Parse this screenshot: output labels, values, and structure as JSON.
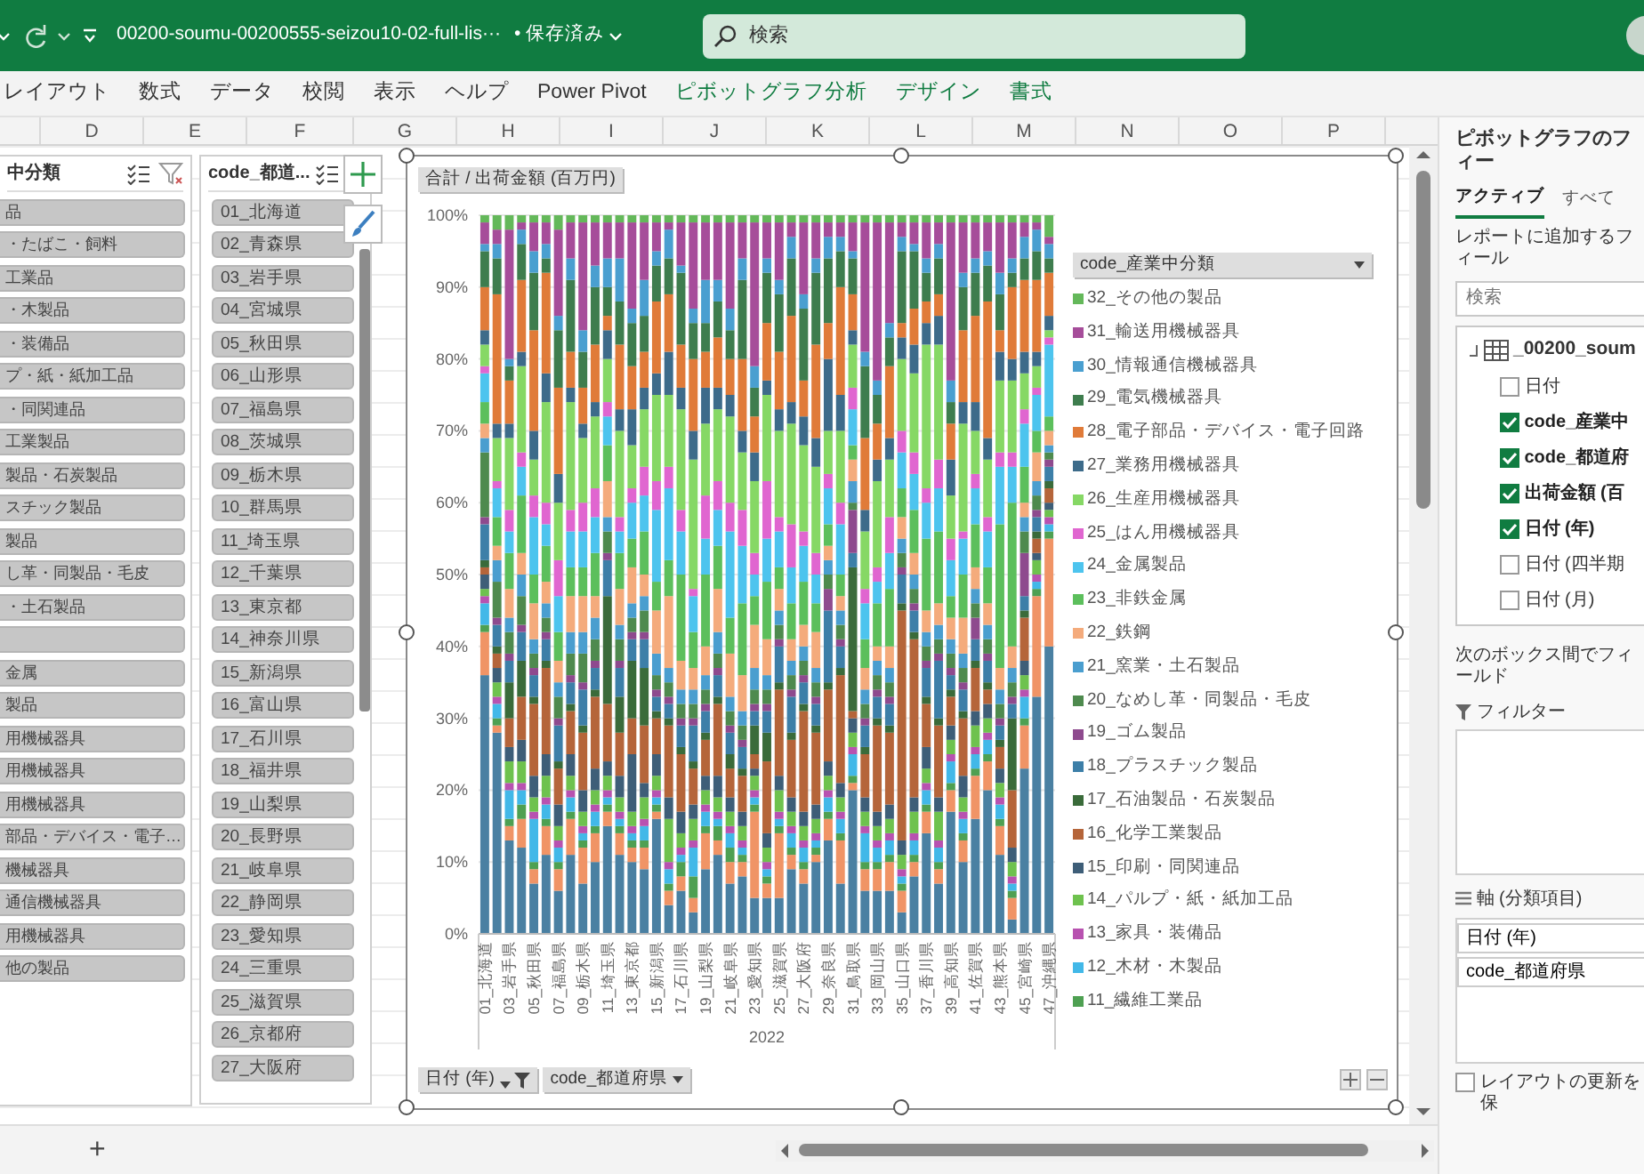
{
  "title_bar": {
    "file_name": "00200-soumu-00200555-seizou10-02-full-lis···",
    "save_status": "• 保存済み",
    "search_placeholder": "検索"
  },
  "ribbon_tabs": [
    {
      "label": "レイアウト",
      "kind": "normal"
    },
    {
      "label": "数式",
      "kind": "normal"
    },
    {
      "label": "データ",
      "kind": "normal"
    },
    {
      "label": "校閲",
      "kind": "normal"
    },
    {
      "label": "表示",
      "kind": "normal"
    },
    {
      "label": "ヘルプ",
      "kind": "normal"
    },
    {
      "label": "Power Pivot",
      "kind": "normal"
    },
    {
      "label": "ピボットグラフ分析",
      "kind": "contextual"
    },
    {
      "label": "デザイン",
      "kind": "contextual"
    },
    {
      "label": "書式",
      "kind": "contextual"
    }
  ],
  "column_headers": [
    "D",
    "E",
    "F",
    "G",
    "H",
    "I",
    "J",
    "K",
    "L",
    "M",
    "N",
    "O",
    "P"
  ],
  "slicers": [
    {
      "title": "中分類",
      "items": [
        {
          "label": "品",
          "selected": true
        },
        {
          "label": "・たばこ・飼料",
          "selected": true
        },
        {
          "label": "工業品",
          "selected": true
        },
        {
          "label": "・木製品",
          "selected": true
        },
        {
          "label": "・装備品",
          "selected": true
        },
        {
          "label": "プ・紙・紙加工品",
          "selected": true
        },
        {
          "label": "・同関連品",
          "selected": true
        },
        {
          "label": "工業製品",
          "selected": true
        },
        {
          "label": "製品・石炭製品",
          "selected": true
        },
        {
          "label": "スチック製品",
          "selected": true
        },
        {
          "label": "製品",
          "selected": true
        },
        {
          "label": "し革・同製品・毛皮",
          "selected": true
        },
        {
          "label": "・土石製品",
          "selected": true
        },
        {
          "selected": true
        },
        {
          "label": "金属",
          "selected": true
        },
        {
          "label": "製品",
          "selected": true
        },
        {
          "label": "用機械器具",
          "selected": true
        },
        {
          "label": "用機械器具",
          "selected": true
        },
        {
          "label": "用機械器具",
          "selected": true
        },
        {
          "label": "部品・デバイス・電子…",
          "selected": true
        },
        {
          "label": "機械器具",
          "selected": true
        },
        {
          "label": "通信機械器具",
          "selected": true
        },
        {
          "label": "用機械器具",
          "selected": true
        },
        {
          "label": "他の製品",
          "selected": true
        }
      ]
    },
    {
      "title": "code_都道...",
      "items": [
        {
          "label": "01_北海道",
          "selected": true
        },
        {
          "label": "02_青森県",
          "selected": true
        },
        {
          "label": "03_岩手県",
          "selected": true
        },
        {
          "label": "04_宮城県",
          "selected": true
        },
        {
          "label": "05_秋田県",
          "selected": true
        },
        {
          "label": "06_山形県",
          "selected": true
        },
        {
          "label": "07_福島県",
          "selected": true
        },
        {
          "label": "08_茨城県",
          "selected": true
        },
        {
          "label": "09_栃木県",
          "selected": true
        },
        {
          "label": "10_群馬県",
          "selected": true
        },
        {
          "label": "11_埼玉県",
          "selected": true
        },
        {
          "label": "12_千葉県",
          "selected": true
        },
        {
          "label": "13_東京都",
          "selected": true
        },
        {
          "label": "14_神奈川県",
          "selected": true
        },
        {
          "label": "15_新潟県",
          "selected": true
        },
        {
          "label": "16_富山県",
          "selected": true
        },
        {
          "label": "17_石川県",
          "selected": true
        },
        {
          "label": "18_福井県",
          "selected": true
        },
        {
          "label": "19_山梨県",
          "selected": true
        },
        {
          "label": "20_長野県",
          "selected": true
        },
        {
          "label": "21_岐阜県",
          "selected": true
        },
        {
          "label": "22_静岡県",
          "selected": true
        },
        {
          "label": "23_愛知県",
          "selected": true
        },
        {
          "label": "24_三重県",
          "selected": true
        },
        {
          "label": "25_滋賀県",
          "selected": true
        },
        {
          "label": "26_京都府",
          "selected": true
        },
        {
          "label": "27_大阪府",
          "selected": true
        }
      ]
    }
  ],
  "chart": {
    "value_field_button": "合計 / 出荷金額 (百万円)",
    "legend_field_button": "code_産業中分類",
    "axis_field_buttons": [
      {
        "label": "日付 (年)",
        "filtered": true
      },
      {
        "label": "code_都道府県",
        "filtered": false
      }
    ],
    "chart_data": {
      "type": "bar",
      "stacked": true,
      "grid": true,
      "orientation": "vertical",
      "xlabel": "2022",
      "xlim": [
        0.5,
        47.5
      ],
      "ylim": [
        0,
        100
      ],
      "x": [
        1,
        2,
        3,
        4,
        5,
        6,
        7,
        8,
        9,
        10,
        11,
        12,
        13,
        14,
        15,
        16,
        17,
        18,
        19,
        20,
        21,
        22,
        23,
        24,
        25,
        26,
        27,
        28,
        29,
        30,
        31,
        32,
        33,
        34,
        35,
        36,
        37,
        38,
        39,
        40,
        41,
        42,
        43,
        44,
        45,
        46,
        47
      ],
      "xticks": [
        {
          "value": 1,
          "label": "01_北海道"
        },
        {
          "value": 3,
          "label": "03_岩手県"
        },
        {
          "value": 5,
          "label": "05_秋田県"
        },
        {
          "value": 7,
          "label": "07_福島県"
        },
        {
          "value": 9,
          "label": "09_栃木県"
        },
        {
          "value": 11,
          "label": "11_埼玉県"
        },
        {
          "value": 13,
          "label": "13_東京都"
        },
        {
          "value": 15,
          "label": "15_新潟県"
        },
        {
          "value": 17,
          "label": "17_石川県"
        },
        {
          "value": 19,
          "label": "19_山梨県"
        },
        {
          "value": 21,
          "label": "21_岐阜県"
        },
        {
          "value": 23,
          "label": "23_愛知県"
        },
        {
          "value": 25,
          "label": "25_滋賀県"
        },
        {
          "value": 27,
          "label": "27_大阪府"
        },
        {
          "value": 29,
          "label": "29_奈良県"
        },
        {
          "value": 31,
          "label": "31_鳥取県"
        },
        {
          "value": 33,
          "label": "33_岡山県"
        },
        {
          "value": 35,
          "label": "35_山口県"
        },
        {
          "value": 37,
          "label": "37_香川県"
        },
        {
          "value": 39,
          "label": "39_高知県"
        },
        {
          "value": 41,
          "label": "41_佐賀県"
        },
        {
          "value": 43,
          "label": "43_熊本県"
        },
        {
          "value": 45,
          "label": "45_宮崎県"
        },
        {
          "value": 47,
          "label": "47_沖縄県"
        }
      ],
      "yticks": [
        {
          "value": 0,
          "label": "0%"
        },
        {
          "value": 10,
          "label": "10%"
        },
        {
          "value": 20,
          "label": "20%"
        },
        {
          "value": 30,
          "label": "30%"
        },
        {
          "value": 40,
          "label": "40%"
        },
        {
          "value": 50,
          "label": "50%"
        },
        {
          "value": 60,
          "label": "60%"
        },
        {
          "value": 70,
          "label": "70%"
        },
        {
          "value": 80,
          "label": "80%"
        },
        {
          "value": 90,
          "label": "90%"
        },
        {
          "value": 100,
          "label": "100%"
        }
      ],
      "series": [
        {
          "color": "#4a80a2",
          "values": [
            36,
            28,
            13,
            12,
            7,
            11,
            6,
            11,
            7,
            10,
            15,
            11,
            10,
            9,
            16,
            4,
            6,
            3,
            9,
            11,
            7,
            8,
            5,
            5,
            5,
            9,
            7,
            10,
            13,
            7,
            20,
            6,
            6,
            6,
            3,
            8,
            14,
            7,
            17,
            10,
            16,
            20,
            11,
            2,
            23,
            33,
            40
          ]
        },
        {
          "color": "#f09466",
          "values": [
            6,
            1,
            2,
            4,
            2,
            4,
            3,
            5,
            5,
            4,
            2,
            3,
            2,
            3,
            1,
            2,
            2,
            2,
            5,
            2,
            3,
            2,
            12,
            2,
            9,
            2,
            2,
            1,
            3,
            6,
            1,
            3,
            3,
            4,
            3,
            2,
            3,
            2,
            3,
            3,
            6,
            4,
            4,
            3,
            6,
            14,
            15
          ]
        },
        {
          "name": "11_繊維工業品",
          "color": "#4ea052",
          "values": [
            1,
            1,
            1,
            2,
            1,
            1,
            1,
            1,
            1,
            1,
            1,
            1,
            1,
            1,
            1,
            1,
            2,
            3,
            1,
            2,
            2,
            1,
            1,
            1,
            1,
            1,
            1,
            1,
            1,
            1,
            1,
            1,
            1,
            1,
            1,
            1,
            1,
            1,
            1,
            1,
            1,
            1,
            1,
            1,
            1,
            1,
            1
          ]
        },
        {
          "name": "12_木材・木製品",
          "color": "#42b8e8",
          "values": [
            3,
            2,
            4,
            2,
            6,
            2,
            2,
            2,
            1,
            2,
            1,
            1,
            1,
            2,
            1,
            2,
            1,
            4,
            2,
            1,
            2,
            1,
            1,
            1,
            1,
            2,
            2,
            1,
            2,
            2,
            3,
            4,
            2,
            2,
            1,
            2,
            2,
            2,
            3,
            2,
            2,
            2,
            2,
            1,
            3,
            1,
            1
          ]
        },
        {
          "name": "13_家具・装備品",
          "color": "#b852b0",
          "values": [
            1,
            1,
            1,
            1,
            1,
            1,
            1,
            1,
            1,
            1,
            1,
            1,
            1,
            1,
            1,
            1,
            1,
            1,
            1,
            1,
            1,
            1,
            1,
            1,
            1,
            1,
            1,
            1,
            1,
            1,
            1,
            1,
            1,
            1,
            1,
            1,
            1,
            1,
            1,
            1,
            1,
            1,
            1,
            1,
            1,
            1,
            1
          ]
        },
        {
          "name": "14_パルプ・紙・紙加工品",
          "color": "#6ec24e",
          "values": [
            1,
            2,
            3,
            3,
            2,
            3,
            2,
            2,
            2,
            2,
            2,
            2,
            2,
            3,
            2,
            6,
            2,
            3,
            2,
            2,
            2,
            2,
            2,
            2,
            3,
            2,
            2,
            2,
            2,
            2,
            2,
            2,
            2,
            2,
            2,
            3,
            2,
            4,
            2,
            2,
            3,
            2,
            2,
            2,
            2,
            2,
            1
          ]
        },
        {
          "name": "15_印刷・同関連品",
          "color": "#3e5e78",
          "values": [
            2,
            2,
            2,
            3,
            3,
            3,
            3,
            3,
            3,
            3,
            2,
            3,
            8,
            2,
            3,
            3,
            3,
            2,
            2,
            3,
            2,
            2,
            1,
            2,
            2,
            2,
            2,
            2,
            2,
            2,
            2,
            2,
            2,
            2,
            2,
            2,
            3,
            2,
            2,
            3,
            2,
            2,
            2,
            2,
            2,
            1,
            1
          ]
        },
        {
          "name": "16_化学工業製品",
          "color": "#b5653a",
          "values": [
            1,
            2,
            4,
            6,
            10,
            12,
            5,
            6,
            8,
            10,
            8,
            6,
            5,
            8,
            5,
            10,
            8,
            5,
            5,
            10,
            4,
            5,
            2,
            10,
            12,
            8,
            14,
            10,
            10,
            15,
            1,
            6,
            12,
            10,
            32,
            22,
            6,
            10,
            4,
            8,
            6,
            2,
            3,
            8,
            6,
            2,
            2
          ]
        },
        {
          "name": "17_石油製品・石炭製品",
          "color": "#3a6b3a",
          "values": [
            1,
            1,
            5,
            5,
            1,
            1,
            1,
            1,
            1,
            1,
            15,
            5,
            8,
            8,
            1,
            1,
            1,
            1,
            1,
            1,
            2,
            1,
            4,
            4,
            1,
            1,
            1,
            1,
            1,
            1,
            20,
            1,
            1,
            1,
            1,
            1,
            1,
            1,
            1,
            1,
            1,
            1,
            1,
            10,
            1,
            1,
            1
          ]
        },
        {
          "name": "18_プラスチック製品",
          "color": "#3d7fa8",
          "values": [
            5,
            3,
            3,
            4,
            3,
            3,
            5,
            3,
            5,
            3,
            5,
            4,
            3,
            4,
            2,
            2,
            3,
            5,
            3,
            3,
            3,
            3,
            2,
            3,
            5,
            5,
            3,
            3,
            10,
            3,
            2,
            3,
            3,
            3,
            4,
            3,
            4,
            8,
            2,
            3,
            3,
            3,
            2,
            2,
            2,
            2,
            2
          ]
        },
        {
          "name": "19_ゴム製品",
          "color": "#8e4a8e",
          "values": [
            1,
            1,
            1,
            1,
            1,
            1,
            1,
            1,
            1,
            1,
            1,
            1,
            1,
            1,
            1,
            1,
            1,
            1,
            1,
            1,
            1,
            1,
            1,
            1,
            1,
            1,
            1,
            1,
            3,
            1,
            6,
            1,
            1,
            1,
            1,
            1,
            1,
            1,
            1,
            1,
            3,
            1,
            1,
            1,
            6,
            1,
            1
          ]
        },
        {
          "name": "20_なめし革・同製品・毛皮",
          "color": "#4e8a4e",
          "values": [
            9,
            5,
            3,
            4,
            2,
            2,
            3,
            3,
            4,
            3,
            3,
            3,
            2,
            3,
            2,
            2,
            2,
            2,
            2,
            2,
            2,
            2,
            2,
            2,
            2,
            2,
            2,
            2,
            2,
            2,
            1,
            2,
            2,
            2,
            2,
            2,
            2,
            2,
            2,
            2,
            2,
            2,
            2,
            2,
            3,
            2,
            1
          ]
        },
        {
          "name": "21_窯業・土石製品",
          "color": "#4a9ecf",
          "values": [
            2,
            3,
            2,
            3,
            2,
            2,
            2,
            3,
            3,
            3,
            2,
            2,
            2,
            2,
            3,
            2,
            2,
            2,
            2,
            3,
            2,
            2,
            3,
            2,
            2,
            2,
            2,
            2,
            2,
            2,
            3,
            2,
            2,
            2,
            2,
            2,
            2,
            2,
            2,
            2,
            2,
            2,
            2,
            2,
            2,
            2,
            1
          ]
        },
        {
          "name": "22_鉄鋼",
          "color": "#f4ab7c",
          "values": [
            2,
            2,
            4,
            3,
            5,
            3,
            3,
            5,
            5,
            3,
            5,
            5,
            5,
            3,
            6,
            10,
            4,
            3,
            4,
            6,
            6,
            5,
            6,
            5,
            3,
            3,
            3,
            5,
            2,
            2,
            3,
            3,
            2,
            3,
            3,
            3,
            3,
            3,
            3,
            5,
            3,
            3,
            3,
            3,
            2,
            4,
            2
          ]
        },
        {
          "name": "23_非鉄金属",
          "color": "#5cbf5c",
          "values": [
            3,
            4,
            5,
            8,
            4,
            5,
            4,
            4,
            4,
            6,
            5,
            5,
            4,
            6,
            4,
            5,
            12,
            5,
            10,
            6,
            5,
            10,
            4,
            8,
            3,
            5,
            6,
            4,
            3,
            3,
            2,
            4,
            6,
            8,
            4,
            6,
            10,
            10,
            3,
            6,
            6,
            5,
            20,
            20,
            5,
            3,
            2
          ]
        },
        {
          "name": "24_金属製品",
          "color": "#4dc4ee",
          "values": [
            4,
            4,
            3,
            4,
            8,
            3,
            5,
            5,
            5,
            5,
            4,
            3,
            5,
            5,
            10,
            10,
            6,
            5,
            5,
            5,
            12,
            8,
            3,
            6,
            5,
            5,
            5,
            4,
            5,
            7,
            5,
            5,
            3,
            5,
            5,
            5,
            5,
            6,
            5,
            5,
            5,
            5,
            8,
            5,
            6,
            5,
            10
          ]
        },
        {
          "name": "25_はん用機械器具",
          "color": "#e066d0",
          "values": [
            1,
            1,
            3,
            2,
            3,
            3,
            5,
            3,
            4,
            4,
            2,
            2,
            2,
            4,
            4,
            3,
            3,
            1,
            6,
            4,
            4,
            5,
            3,
            8,
            2,
            6,
            2,
            3,
            2,
            3,
            3,
            2,
            2,
            5,
            3,
            3,
            2,
            4,
            3,
            1,
            2,
            2,
            2,
            2,
            2,
            1,
            1
          ]
        },
        {
          "name": "26_生産用機械器具",
          "color": "#86d865",
          "values": [
            3,
            6,
            10,
            12,
            5,
            14,
            8,
            15,
            9,
            10,
            6,
            12,
            6,
            8,
            12,
            10,
            14,
            18,
            10,
            10,
            12,
            8,
            10,
            12,
            12,
            14,
            12,
            12,
            6,
            10,
            6,
            8,
            12,
            8,
            10,
            11,
            20,
            16,
            6,
            15,
            6,
            8,
            10,
            10,
            5,
            3,
            1
          ]
        },
        {
          "name": "27_業務用機械器具",
          "color": "#3d6b8a",
          "values": [
            2,
            2,
            2,
            2,
            4,
            4,
            4,
            2,
            2,
            2,
            4,
            3,
            5,
            3,
            3,
            6,
            3,
            4,
            5,
            3,
            3,
            3,
            4,
            2,
            3,
            3,
            4,
            4,
            10,
            5,
            2,
            3,
            3,
            3,
            3,
            4,
            3,
            4,
            5,
            3,
            4,
            3,
            4,
            3,
            3,
            2,
            2
          ]
        },
        {
          "name": "28_電子部品・デバイス・電子回路",
          "color": "#e07b39",
          "values": [
            6,
            18,
            6,
            10,
            14,
            14,
            12,
            5,
            5,
            8,
            2,
            9,
            6,
            5,
            10,
            8,
            6,
            10,
            5,
            7,
            5,
            10,
            5,
            8,
            8,
            12,
            5,
            13,
            5,
            15,
            5,
            10,
            5,
            10,
            2,
            5,
            3,
            3,
            5,
            10,
            12,
            19,
            3,
            10,
            10,
            10,
            6
          ]
        },
        {
          "name": "29_電気機械器具",
          "color": "#3e7d4e",
          "values": [
            5,
            5,
            2,
            5,
            8,
            2,
            8,
            10,
            5,
            8,
            4,
            6,
            6,
            5,
            5,
            5,
            10,
            5,
            4,
            5,
            4,
            11,
            4,
            7,
            8,
            8,
            10,
            10,
            9,
            5,
            5,
            10,
            4,
            4,
            10,
            8,
            4,
            5,
            3,
            6,
            6,
            5,
            5,
            2,
            3,
            4,
            2
          ]
        },
        {
          "name": "30_情報通信機械器具",
          "color": "#4a9fd0",
          "values": [
            1,
            2,
            1,
            2,
            3,
            2,
            2,
            3,
            3,
            3,
            4,
            6,
            2,
            5,
            2,
            4,
            1,
            2,
            6,
            3,
            3,
            3,
            3,
            2,
            2,
            3,
            2,
            2,
            3,
            2,
            1,
            2,
            2,
            2,
            2,
            1,
            2,
            2,
            3,
            2,
            2,
            2,
            3,
            2,
            3,
            3,
            2
          ]
        },
        {
          "name": "31_輸送用機械器具",
          "color": "#a64d9a",
          "values": [
            3,
            2,
            18,
            1,
            4,
            3,
            12,
            5,
            15,
            6,
            5,
            5,
            12,
            8,
            4,
            1,
            6,
            12,
            8,
            8,
            12,
            5,
            20,
            5,
            8,
            2,
            10,
            5,
            2,
            2,
            4,
            18,
            22,
            14,
            2,
            3,
            5,
            3,
            22,
            7,
            5,
            4,
            7,
            5,
            2,
            1,
            1
          ]
        },
        {
          "name": "32_その他の製品",
          "color": "#64b85a",
          "values": [
            1,
            2,
            2,
            1,
            1,
            1,
            2,
            1,
            1,
            1,
            1,
            1,
            1,
            1,
            1,
            1,
            1,
            1,
            1,
            1,
            1,
            1,
            1,
            1,
            1,
            1,
            1,
            1,
            1,
            1,
            1,
            1,
            1,
            1,
            1,
            1,
            1,
            1,
            1,
            1,
            1,
            1,
            1,
            1,
            1,
            1,
            3
          ]
        }
      ]
    }
  },
  "field_pane": {
    "title": "ピボットグラフのフィー",
    "tabs": [
      {
        "label": "アクティブ",
        "selected": true
      },
      {
        "label": "すべて",
        "selected": false
      }
    ],
    "instruction": "レポートに追加するフィール",
    "search_placeholder": "検索",
    "table_name": "_00200_soum",
    "fields": [
      {
        "label": "日付",
        "checked": false
      },
      {
        "label": "code_産業中",
        "checked": true
      },
      {
        "label": "code_都道府",
        "checked": true
      },
      {
        "label": "出荷金額 (百",
        "checked": true
      },
      {
        "label": "日付 (年)",
        "checked": true
      },
      {
        "label": "日付 (四半期",
        "checked": false
      },
      {
        "label": "日付 (月)",
        "checked": false
      }
    ],
    "areas_instruction": "次のボックス間でフィールド",
    "filter_area": {
      "title": "フィルター"
    },
    "axis_area": {
      "title": "軸 (分類項目)",
      "items": [
        "日付 (年)",
        "code_都道府県"
      ]
    },
    "defer_update": {
      "label": "レイアウトの更新を保",
      "checked": false
    }
  },
  "sheet_bar": {
    "add_sheet_button": "+"
  }
}
